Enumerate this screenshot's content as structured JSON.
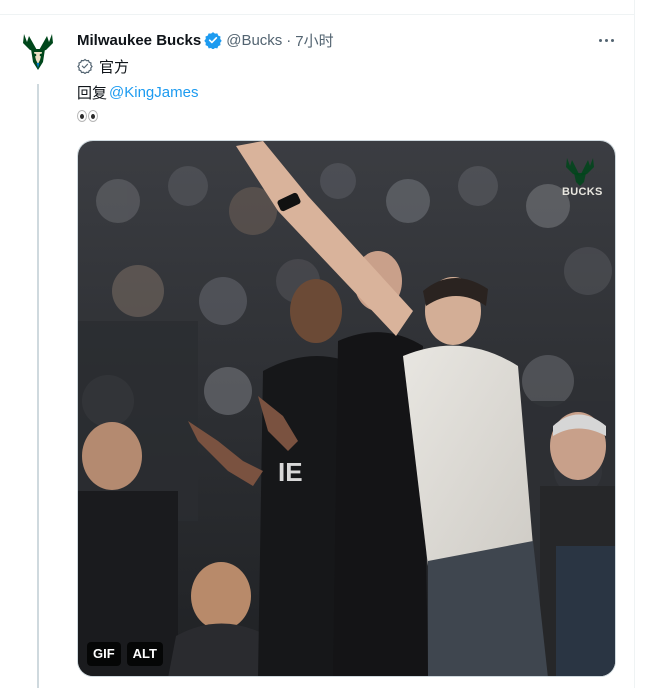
{
  "tweet": {
    "display_name": "Milwaukee Bucks",
    "handle": "@Bucks",
    "separator": "·",
    "time": "7小时",
    "official_label": "官方",
    "reply_prefix": "回复",
    "reply_mention": "@KingJames",
    "body_emoji": "👀",
    "media": {
      "gif_badge": "GIF",
      "alt_badge": "ALT",
      "watermark_text": "BUCKS"
    }
  },
  "colors": {
    "accent": "#1d9bf0",
    "text_primary": "#0f1419",
    "text_secondary": "#536471",
    "bucks_green": "#00471b"
  },
  "icons": {
    "avatar": "bucks-deer-logo",
    "verified": "verified-badge-icon",
    "official": "official-check-icon",
    "more": "more-dots-icon"
  }
}
